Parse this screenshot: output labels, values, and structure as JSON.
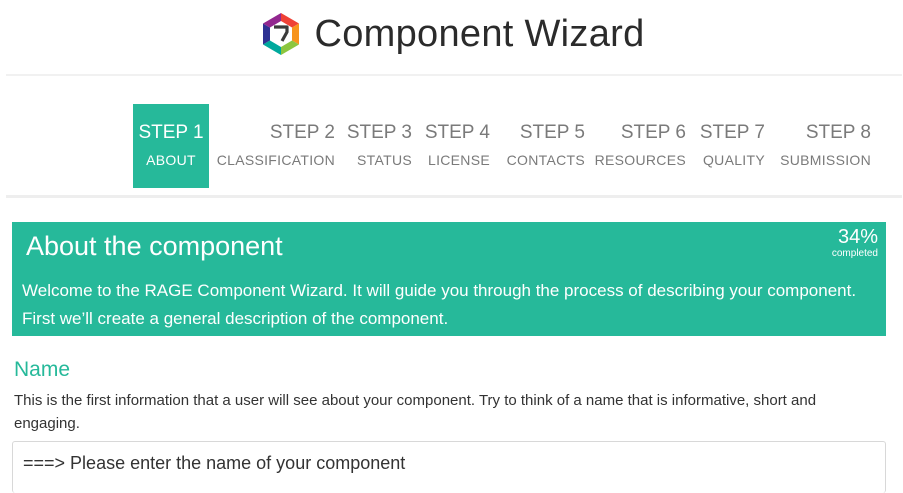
{
  "header": {
    "title": "Component Wizard",
    "logo_icon": "rage-hexagon-logo"
  },
  "colors": {
    "accent": "#26b99a",
    "text": "#333333",
    "muted": "#7a7a7a"
  },
  "steps": [
    {
      "number": "STEP 1",
      "label": "ABOUT",
      "active": true
    },
    {
      "number": "STEP 2",
      "label": "CLASSIFICATION",
      "active": false
    },
    {
      "number": "STEP 3",
      "label": "STATUS",
      "active": false
    },
    {
      "number": "STEP 4",
      "label": "LICENSE",
      "active": false
    },
    {
      "number": "STEP 5",
      "label": "CONTACTS",
      "active": false
    },
    {
      "number": "STEP 6",
      "label": "RESOURCES",
      "active": false
    },
    {
      "number": "STEP 7",
      "label": "QUALITY",
      "active": false
    },
    {
      "number": "STEP 8",
      "label": "SUBMISSION",
      "active": false
    }
  ],
  "banner": {
    "title": "About the component",
    "progress_value": "34%",
    "progress_caption": "completed",
    "text": "Welcome to the RAGE Component Wizard. It will guide you through the process of describing your component. First we’ll create a general description of the component."
  },
  "name_section": {
    "title": "Name",
    "help": "This is the first information that a user will see about your component. Try to think of a name that is informative, short and engaging.",
    "placeholder": "===> Please enter the name of your component",
    "value": ""
  }
}
